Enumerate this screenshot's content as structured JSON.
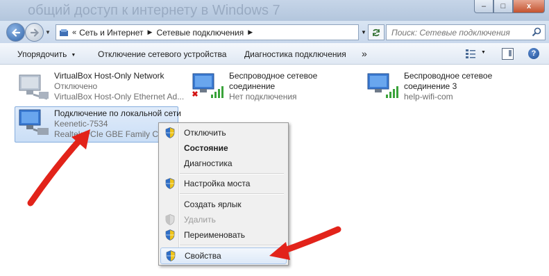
{
  "window": {
    "background_title": "общий доступ к интернету в Windows 7",
    "minimize": "–",
    "maximize": "□",
    "close": "x"
  },
  "nav": {
    "breadcrumb": [
      "Сеть и Интернет",
      "Сетевые подключения"
    ],
    "breadcrumb_prefix": "«",
    "search_placeholder": "Поиск: Сетевые подключения"
  },
  "toolbar": {
    "organize": "Упорядочить",
    "disable_device": "Отключение сетевого устройства",
    "diagnose": "Диагностика подключения",
    "more": "»",
    "help": "?"
  },
  "connections": [
    {
      "name": "VirtualBox Host-Only Network",
      "status": "Отключено",
      "device": "VirtualBox Host-Only Ethernet Ad..."
    },
    {
      "name": "Беспроводное сетевое",
      "name2": "соединение",
      "status": "Нет подключения"
    },
    {
      "name": "Беспроводное сетевое",
      "name2": "соединение 3",
      "status": "help-wifi-com"
    },
    {
      "name": "Подключение по локальной сети",
      "status": "Keenetic-7534",
      "device": "Realtek PCIe GBE Family Con..."
    }
  ],
  "context_menu": {
    "items": [
      {
        "label": "Отключить",
        "shield": true
      },
      {
        "label": "Состояние",
        "bold": true
      },
      {
        "label": "Диагностика"
      },
      {
        "label": "Настройка моста",
        "shield": true
      },
      {
        "label": "Создать ярлык"
      },
      {
        "label": "Удалить",
        "shield": true,
        "disabled": true
      },
      {
        "label": "Переименовать",
        "shield": true
      },
      {
        "label": "Свойства",
        "shield": true,
        "hover": true
      }
    ]
  },
  "colors": {
    "annotation_arrow": "#e2231a",
    "selection": "#cadef6",
    "signal_green": "#3aa33a"
  }
}
